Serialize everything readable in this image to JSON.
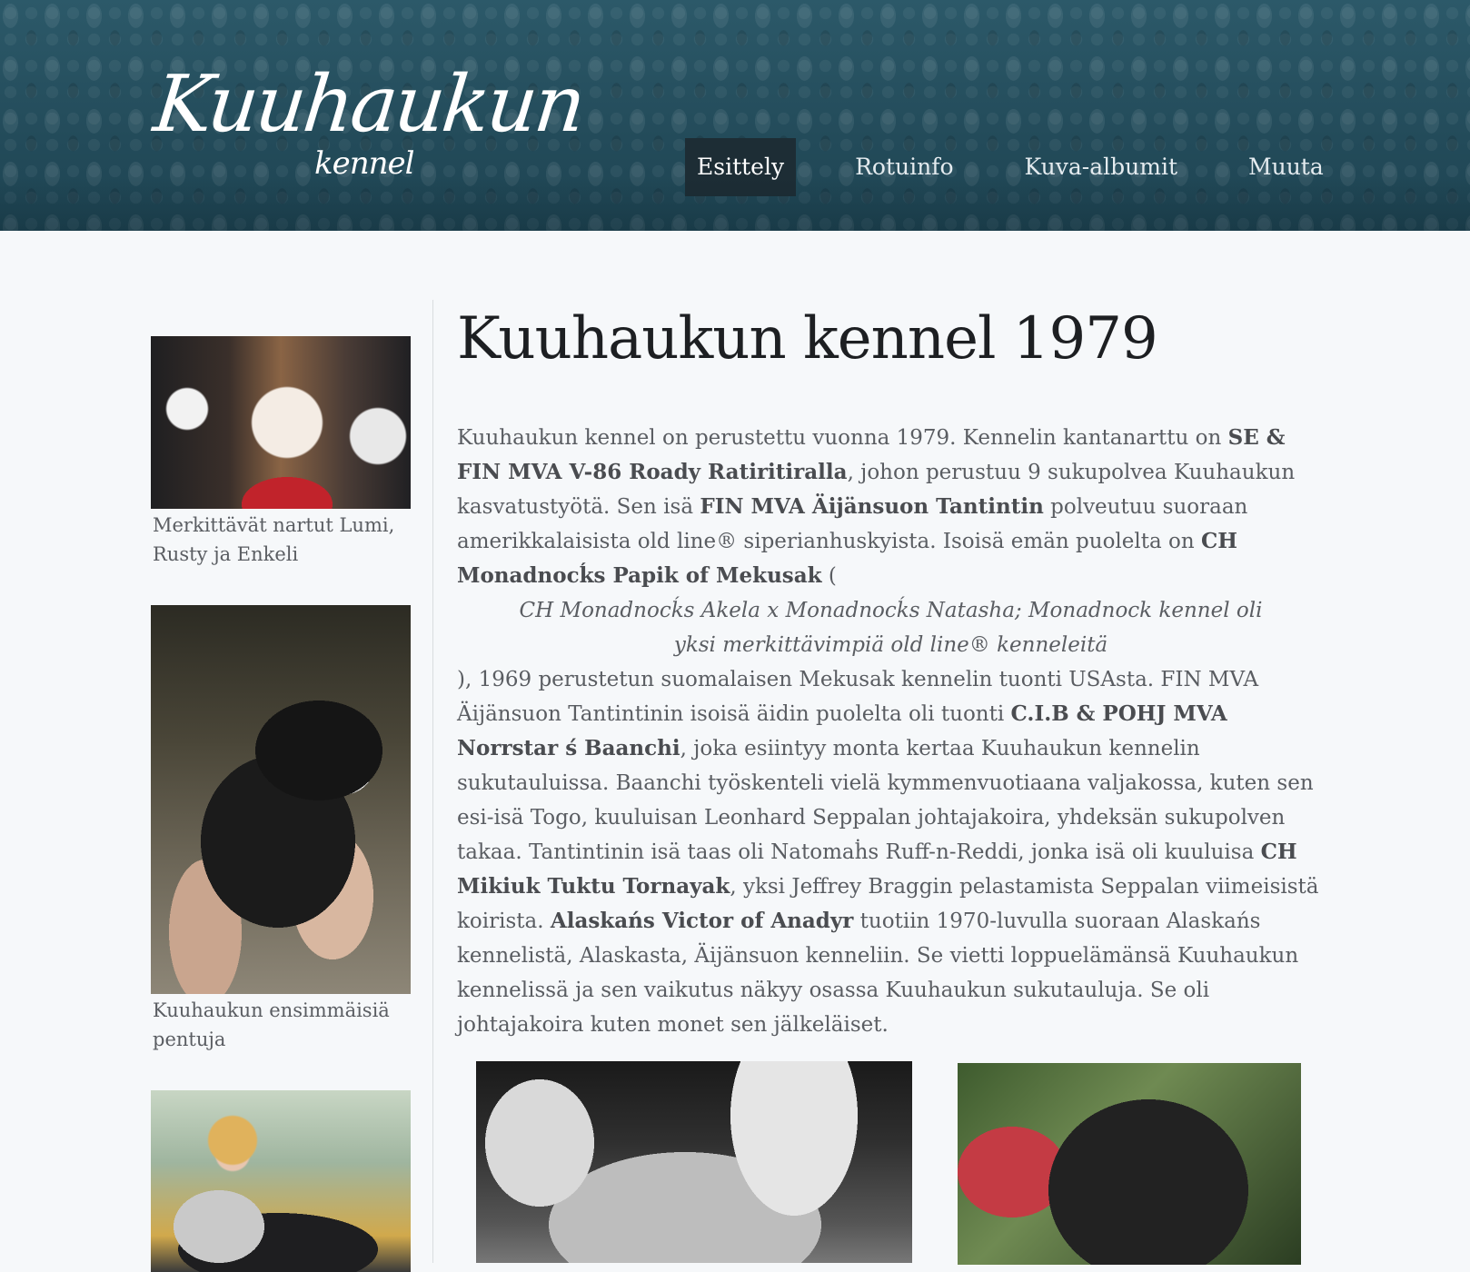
{
  "header": {
    "logo": {
      "script": "Kuuhaukun",
      "sub": "kennel"
    },
    "nav": [
      {
        "label": "Esittely",
        "active": true
      },
      {
        "label": "Rotuinfo",
        "active": false
      },
      {
        "label": "Kuva-albumit",
        "active": false
      },
      {
        "label": "Muuta",
        "active": false
      }
    ]
  },
  "sidebar": {
    "items": [
      {
        "caption": "Merkittävät nartut Lumi, Rusty ja Enkeli"
      },
      {
        "caption": "Kuuhaukun ensimmäisiä pentuja"
      },
      {
        "caption": ""
      }
    ]
  },
  "main": {
    "title": "Kuuhaukun kennel 1979",
    "p1": "Kuuhaukun kennel on perustettu vuonna 1979. Kennelin kantanarttu on ",
    "b1": "SE & FIN MVA V-86 Roady Ratiritiralla",
    "p2": ", johon perustuu 9 sukupolvea Kuuhaukun kasvatustyötä. Sen isä ",
    "b2": "FIN MVA Äijänsuon Tantintin",
    "p3": " polveutuu suoraan amerikkalaisista old line® siperianhuskyista. Isoisä emän puolelta on ",
    "b3": "CH Monadnocḱs Papik of Mekusak",
    "p4": " (",
    "quote": "CH Monadnocḱs Akela x Monadnocḱs Natasha; Monadnock kennel oli yksi merkittävimpiä old line® kenneleitä",
    "p5": "), 1969 perustetun suomalaisen Mekusak kennelin tuonti USAsta. FIN MVA Äijänsuon Tantintinin isoisä äidin puolelta oli tuonti ",
    "b4": "C.I.B & POHJ MVA Norrstar ś Baanchi",
    "p6": ", joka esiintyy monta kertaa Kuuhaukun kennelin sukutauluissa. Baanchi työskenteli vielä kymmenvuotiaana valjakossa, kuten sen esi-isä Togo, kuuluisan Leonhard Seppalan johtajakoira, yhdeksän sukupolven takaa. Tantintinin isä taas oli Natomaḣs Ruff-n-Reddi, jonka isä oli kuuluisa ",
    "b5": "CH Mikiuk Tuktu Tornayak",
    "p7": ", yksi Jeffrey Braggin pelastamista Seppalan viimeisistä koirista. ",
    "b6": "Alaskańs Victor of Anadyr",
    "p8": " tuotiin 1970-luvulla suoraan Alaskańs kennelistä, Alaskasta, Äijänsuon kenneliin. Se vietti loppuelämänsä Kuuhaukun kennelissä ja sen vaikutus näkyy osassa Kuuhaukun sukutauluja. Se oli johtajakoira kuten monet sen jälkeläiset."
  }
}
